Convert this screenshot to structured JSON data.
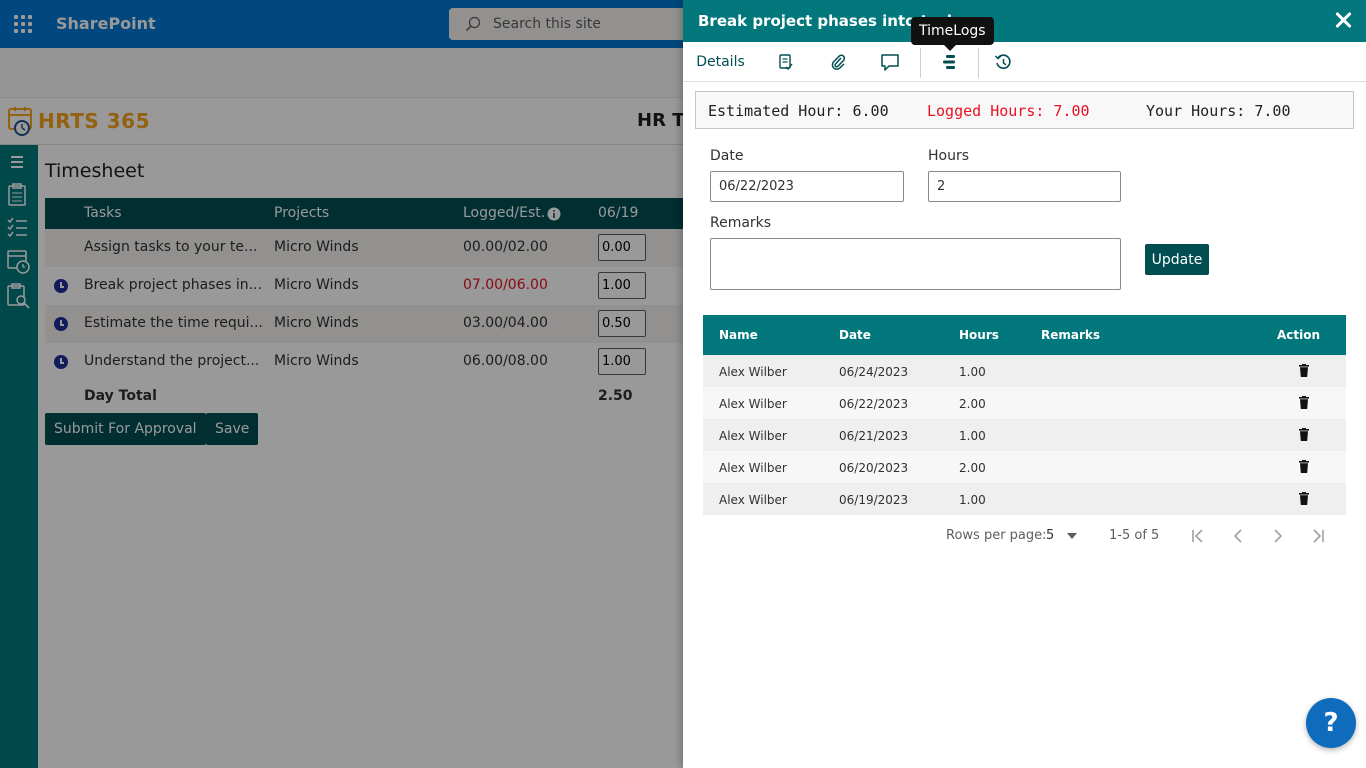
{
  "suite": {
    "app_name": "SharePoint",
    "search_placeholder": "Search this site"
  },
  "app": {
    "logo_text": "HRTS 365",
    "title": "HR Ti"
  },
  "timesheet": {
    "title": "Timesheet",
    "columns": [
      "Tasks",
      "Projects",
      "Logged/Est.",
      "06/19"
    ],
    "rows": [
      {
        "task": "Assign tasks to your te...",
        "project": "Micro Winds",
        "logged": "00.00/02.00",
        "hours": "0.00",
        "over": false,
        "clock": false
      },
      {
        "task": "Break project phases in...",
        "project": "Micro Winds",
        "logged": "07.00/06.00",
        "hours": "1.00",
        "over": true,
        "clock": true
      },
      {
        "task": "Estimate the time requi...",
        "project": "Micro Winds",
        "logged": "03.00/04.00",
        "hours": "0.50",
        "over": false,
        "clock": true
      },
      {
        "task": "Understand the project...",
        "project": "Micro Winds",
        "logged": "06.00/08.00",
        "hours": "1.00",
        "over": false,
        "clock": true
      }
    ],
    "total_label": "Day Total",
    "total_value": "2.50",
    "submit_label": "Submit For Approval",
    "save_label": "Save"
  },
  "panel": {
    "title": "Break project phases into task",
    "tabs": {
      "details": "Details"
    },
    "tooltip": "TimeLogs",
    "summary": {
      "estimated": "Estimated Hour: 6.00",
      "logged": "Logged Hours: 7.00",
      "yours": "Your Hours: 7.00"
    },
    "form": {
      "date_label": "Date",
      "date_value": "06/22/2023",
      "hours_label": "Hours",
      "hours_value": "2",
      "remarks_label": "Remarks",
      "remarks_value": "",
      "update_label": "Update"
    },
    "log_table": {
      "columns": [
        "Name",
        "Date",
        "Hours",
        "Remarks",
        "Action"
      ],
      "rows": [
        {
          "name": "Alex Wilber",
          "date": "06/24/2023",
          "hours": "1.00",
          "remarks": ""
        },
        {
          "name": "Alex Wilber",
          "date": "06/22/2023",
          "hours": "2.00",
          "remarks": ""
        },
        {
          "name": "Alex Wilber",
          "date": "06/21/2023",
          "hours": "1.00",
          "remarks": ""
        },
        {
          "name": "Alex Wilber",
          "date": "06/20/2023",
          "hours": "2.00",
          "remarks": ""
        },
        {
          "name": "Alex Wilber",
          "date": "06/19/2023",
          "hours": "1.00",
          "remarks": ""
        }
      ]
    },
    "pager": {
      "rows_label": "Rows per page:",
      "rows_value": "5",
      "range": "1-5 of 5"
    }
  },
  "help_label": "?",
  "colors": {
    "suite": "#0078d4",
    "teal": "#03787c",
    "dark_teal": "#004e52",
    "over_budget": "#e81123",
    "logo": "#f7a21b",
    "help": "#0f6cbd"
  }
}
